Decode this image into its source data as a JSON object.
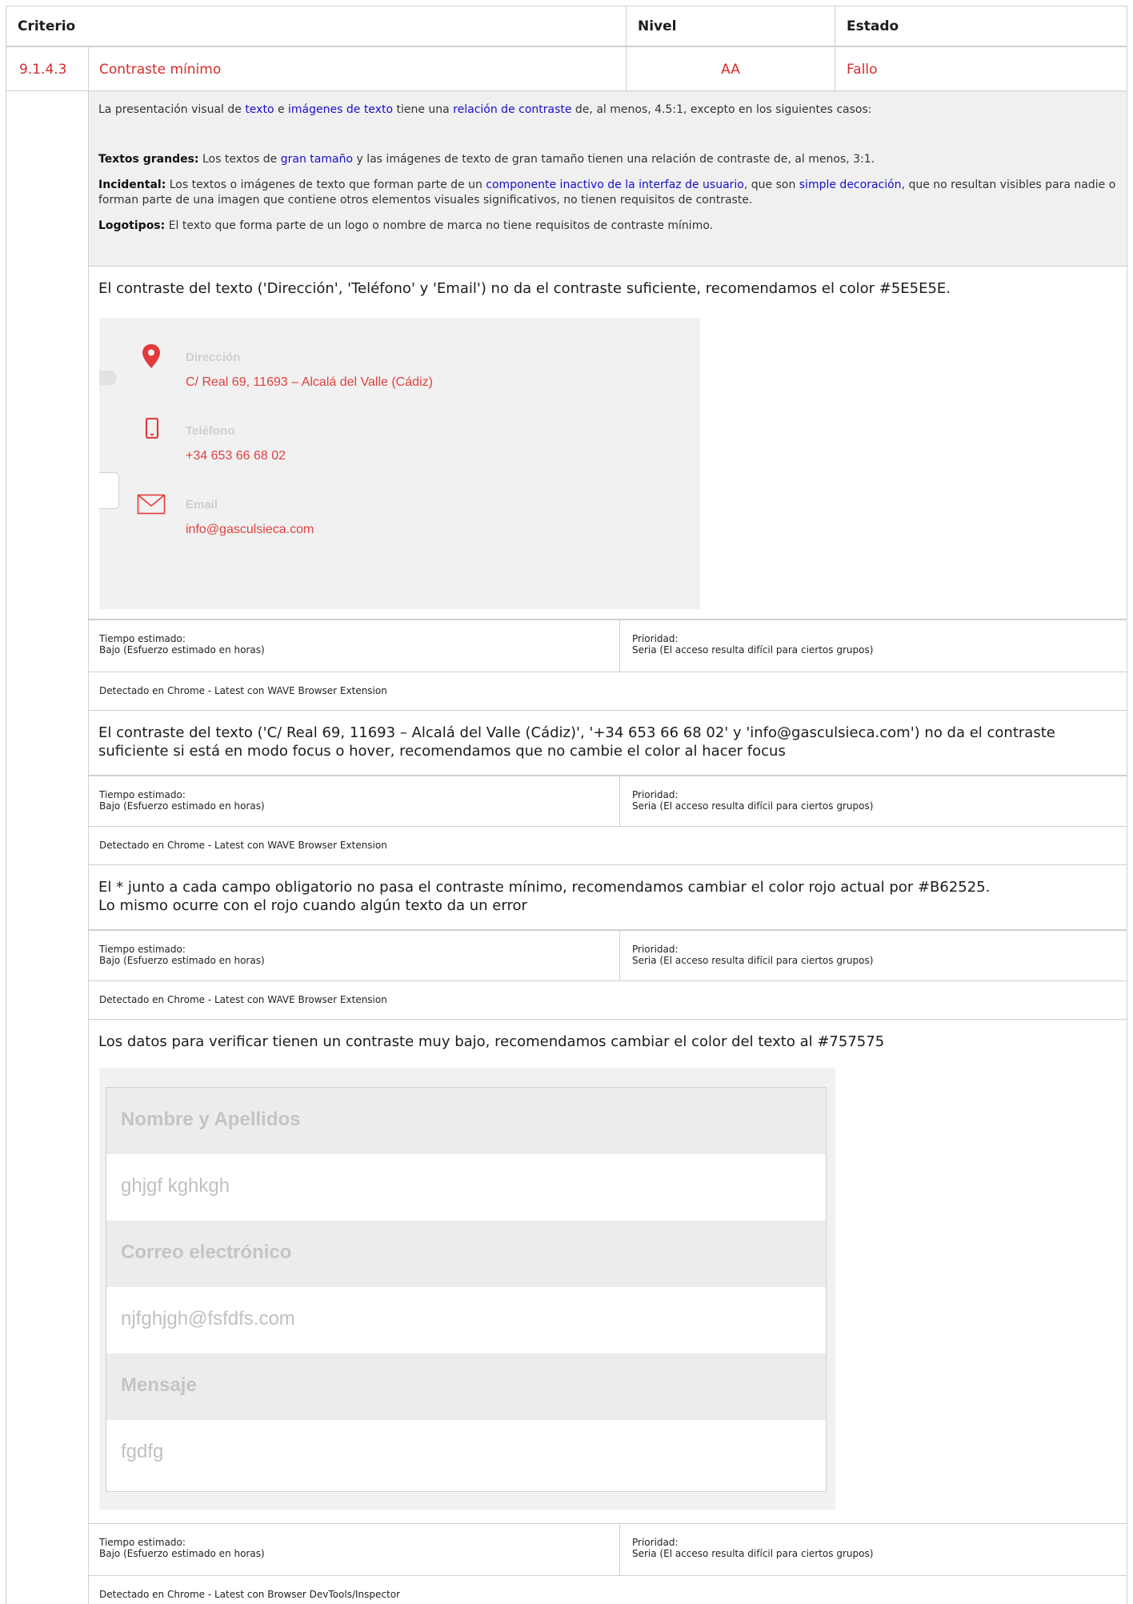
{
  "header": {
    "criterio": "Criterio",
    "nivel": "Nivel",
    "estado": "Estado"
  },
  "criterion": {
    "id": "9.1.4.3",
    "name": "Contraste mínimo",
    "level": "AA",
    "status": "Fallo"
  },
  "description": {
    "intro": {
      "t1": "La presentación visual de ",
      "l1": "texto",
      "t2": " e ",
      "l2": "imágenes de texto",
      "t3": " tiene una ",
      "l3": "relación de contraste",
      "t4": " de, al menos, 4.5:1, excepto en los siguientes casos:"
    },
    "large": {
      "label": "Textos grandes:",
      "t1": " Los textos de ",
      "l1": "gran tamaño",
      "t2": " y las imágenes de texto de gran tamaño tienen una relación de contraste de, al menos, 3:1."
    },
    "incidental": {
      "label": "Incidental:",
      "t1": " Los textos o imágenes de texto que forman parte de un ",
      "l1": "componente inactivo de la interfaz de usuario",
      "t2": ", que son ",
      "l2": "simple decoración",
      "t3": ", que no resultan visibles para nadie o forman parte de una imagen que contiene otros elementos visuales significativos, no tienen requisitos de contraste."
    },
    "logos": {
      "label": "Logotipos:",
      "t1": " El texto que forma parte de un logo o nombre de marca no tiene requisitos de contraste mínimo."
    }
  },
  "meta_labels": {
    "tiempo_label": "Tiempo estimado:",
    "tiempo_value": "Bajo (Esfuerzo estimado en horas)",
    "prioridad_label": "Prioridad:",
    "prioridad_value": "Seria (El acceso resulta difícil para ciertos grupos)"
  },
  "findings": [
    {
      "text": "El contraste del texto ('Dirección', 'Teléfono' y 'Email') no da el contraste suficiente, recomendamos el color #5E5E5E.",
      "detected": "Detectado en Chrome - Latest con WAVE Browser Extension"
    },
    {
      "text": "El contraste del texto ('C/ Real 69, 11693 – Alcalá del Valle (Cádiz)', '+34 653 66 68 02' y 'info@gasculsieca.com') no da el contraste suficiente si está en modo focus o hover, recomendamos que no cambie el color al hacer focus",
      "detected": "Detectado en Chrome - Latest con WAVE Browser Extension"
    },
    {
      "line1": "El * junto a cada campo obligatorio no pasa el contraste mínimo, recomendamos cambiar el color rojo actual por #B62525.",
      "line2": "Lo mismo ocurre con el rojo cuando algún texto da un error",
      "detected": "Detectado en Chrome - Latest con WAVE Browser Extension"
    },
    {
      "text": "Los datos para verificar tienen un contraste muy bajo, recomendamos cambiar el color del texto al #757575",
      "detected": "Detectado en Chrome - Latest con Browser DevTools/Inspector"
    }
  ],
  "contact_shot": {
    "direccion_label": "Dirección",
    "direccion_value": "C/ Real 69, 11693 – Alcalá del Valle (Cádiz)",
    "telefono_label": "Teléfono",
    "telefono_value": "+34 653 66 68 02",
    "email_label": "Email",
    "email_value": "info@gasculsieca.com"
  },
  "form_shot": {
    "nombre_label": "Nombre y Apellidos",
    "nombre_value": "ghjgf kghkgh",
    "correo_label": "Correo electrónico",
    "correo_value": "njfghjgh@fsfdfs.com",
    "mensaje_label": "Mensaje",
    "mensaje_value": "fgdfg"
  },
  "colors": {
    "fail_red": "#d42b2b",
    "link_blue": "#1a0dcc",
    "icon_red": "#e23b3b"
  }
}
